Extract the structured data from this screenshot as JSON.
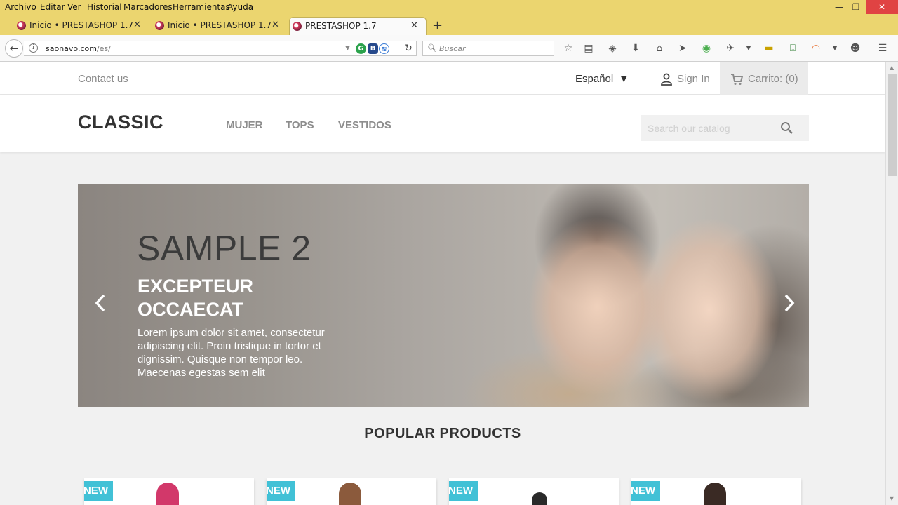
{
  "browser": {
    "menu": [
      "Archivo",
      "Editar",
      "Ver",
      "Historial",
      "Marcadores",
      "Herramientas",
      "Ayuda"
    ],
    "window_controls": {
      "minimize": "—",
      "restore": "❐",
      "close": "✕"
    },
    "tabs": [
      {
        "title": "Inicio • PRESTASHOP 1.7",
        "active": false
      },
      {
        "title": "Inicio • PRESTASHOP 1.7",
        "active": false
      },
      {
        "title": "PRESTASHOP 1.7",
        "active": true
      }
    ],
    "url": {
      "host": "saonavo.com",
      "path": "/es/"
    },
    "search_placeholder": "Buscar"
  },
  "shop": {
    "topbar": {
      "contact": "Contact us",
      "language": "Español",
      "sign_in": "Sign In",
      "cart": "Carrito: (0)"
    },
    "header": {
      "logo": "CLASSIC",
      "nav": [
        "MUJER",
        "TOPS",
        "VESTIDOS"
      ],
      "search_placeholder": "Search our catalog"
    },
    "slider": {
      "title": "SAMPLE 2",
      "subtitle": "EXCEPTEUR OCCAECAT",
      "description": "Lorem ipsum dolor sit amet, consectetur adipiscing elit. Proin tristique in tortor et dignissim. Quisque non tempor leo. Maecenas egestas sem elit"
    },
    "popular": {
      "title": "POPULAR PRODUCTS",
      "products": [
        {
          "badge": "NEW"
        },
        {
          "badge": "NEW"
        },
        {
          "badge": "NEW"
        },
        {
          "badge": "NEW"
        }
      ]
    }
  },
  "colors": {
    "chrome": "#ebd56f",
    "badge": "#41c1d6",
    "page_bg": "#f1f1f1"
  }
}
